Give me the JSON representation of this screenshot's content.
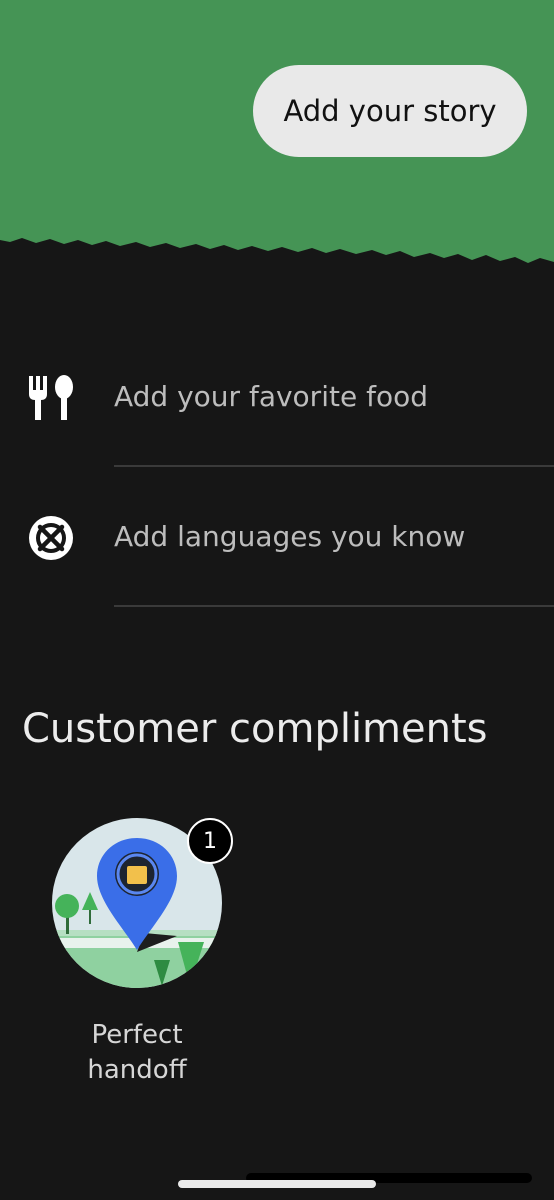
{
  "colors": {
    "header_green": "#459455",
    "background": "#161616",
    "pill": "#e9e9e9",
    "muted_text": "#bdbdbd",
    "pin_blue": "#3a6ee8"
  },
  "header": {
    "story_button_label": "Add your story"
  },
  "profile_rows": [
    {
      "icon": "fork-spoon-icon",
      "label": "Add your favorite food"
    },
    {
      "icon": "globe-crossed-icon",
      "label": "Add languages you know"
    }
  ],
  "compliments": {
    "title": "Customer compliments",
    "items": [
      {
        "icon": "location-pin-bag-icon",
        "count": "1",
        "line1": "Perfect",
        "line2": "handoff"
      }
    ]
  }
}
